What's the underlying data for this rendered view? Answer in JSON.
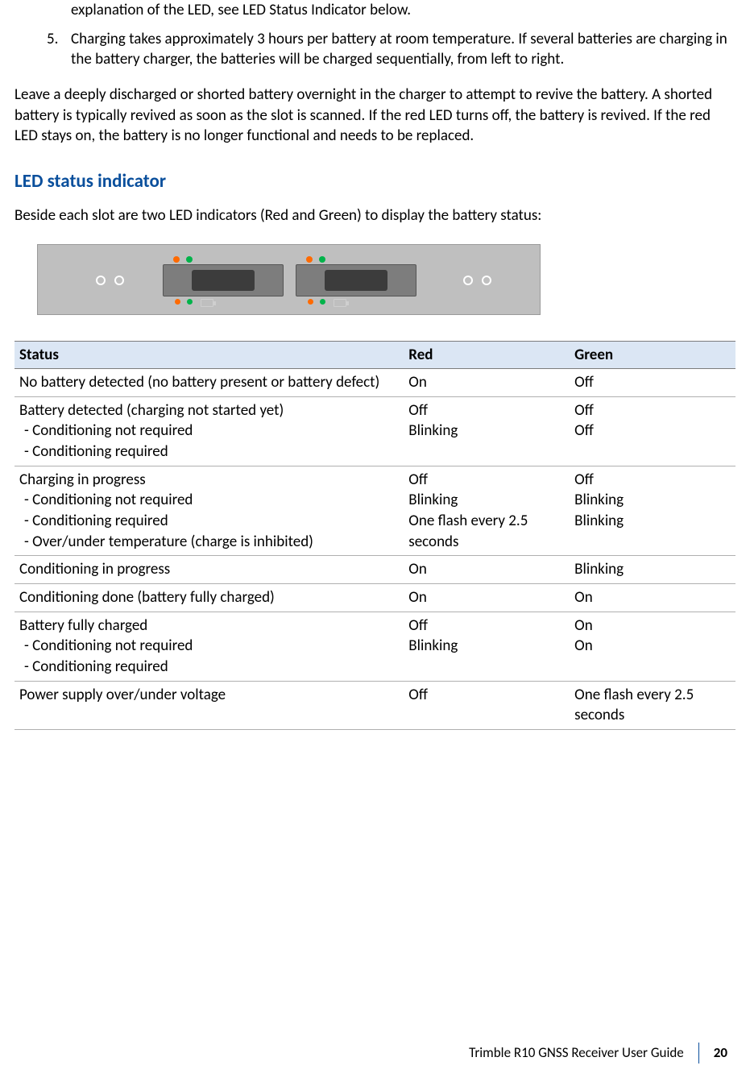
{
  "intro": {
    "line4b": "explanation of the LED, see LED Status Indicator below.",
    "item5_num": "5.",
    "item5": "Charging takes approximately 3 hours per battery at room temperature. If several batteries are charging in the battery charger, the batteries will be charged sequentially, from left to right."
  },
  "paragraph_revive": "Leave a deeply discharged or shorted battery overnight in the charger to attempt to revive the battery. A shorted battery is typically revived as soon as the slot is scanned. If the red LED turns off, the battery is revived. If the red LED stays on, the battery is no longer functional and needs to be replaced.",
  "heading_led": "LED status indicator",
  "paragraph_led": "Beside each slot are two LED indicators (Red and Green) to display the battery status:",
  "table": {
    "headers": {
      "status": "Status",
      "red": "Red",
      "green": "Green"
    },
    "rows": [
      {
        "status_main": "No battery detected (no battery present or battery defect)",
        "status_subs": [],
        "red": [
          "On"
        ],
        "green": [
          "Off"
        ]
      },
      {
        "status_main": "Battery detected (charging not started yet)",
        "status_subs": [
          " - Conditioning not required",
          " - Conditioning required"
        ],
        "red": [
          "",
          "Off",
          "Blinking"
        ],
        "green": [
          "",
          "Off",
          "Off"
        ]
      },
      {
        "status_main": "Charging in progress",
        "status_subs": [
          " - Conditioning not required",
          " - Conditioning required",
          " - Over/under temperature (charge is inhibited)"
        ],
        "red": [
          "",
          "Off",
          "Blinking",
          "One flash every 2.5 seconds"
        ],
        "green": [
          "",
          "Off",
          "Blinking",
          "Blinking"
        ]
      },
      {
        "status_main": "Conditioning in progress",
        "status_subs": [],
        "red": [
          "On"
        ],
        "green": [
          "Blinking"
        ]
      },
      {
        "status_main": "Conditioning done (battery fully charged)",
        "status_subs": [],
        "red": [
          "On"
        ],
        "green": [
          "On"
        ]
      },
      {
        "status_main": "Battery fully charged",
        "status_subs": [
          " - Conditioning not required",
          " - Conditioning required"
        ],
        "red": [
          "",
          "Off",
          "Blinking"
        ],
        "green": [
          "",
          "On",
          "On"
        ]
      },
      {
        "status_main": "Power supply over/under voltage",
        "status_subs": [],
        "red": [
          "Off"
        ],
        "green": [
          "One flash every 2.5 seconds"
        ]
      }
    ]
  },
  "footer": {
    "guide": "Trimble R10 GNSS Receiver User Guide",
    "page": "20"
  }
}
